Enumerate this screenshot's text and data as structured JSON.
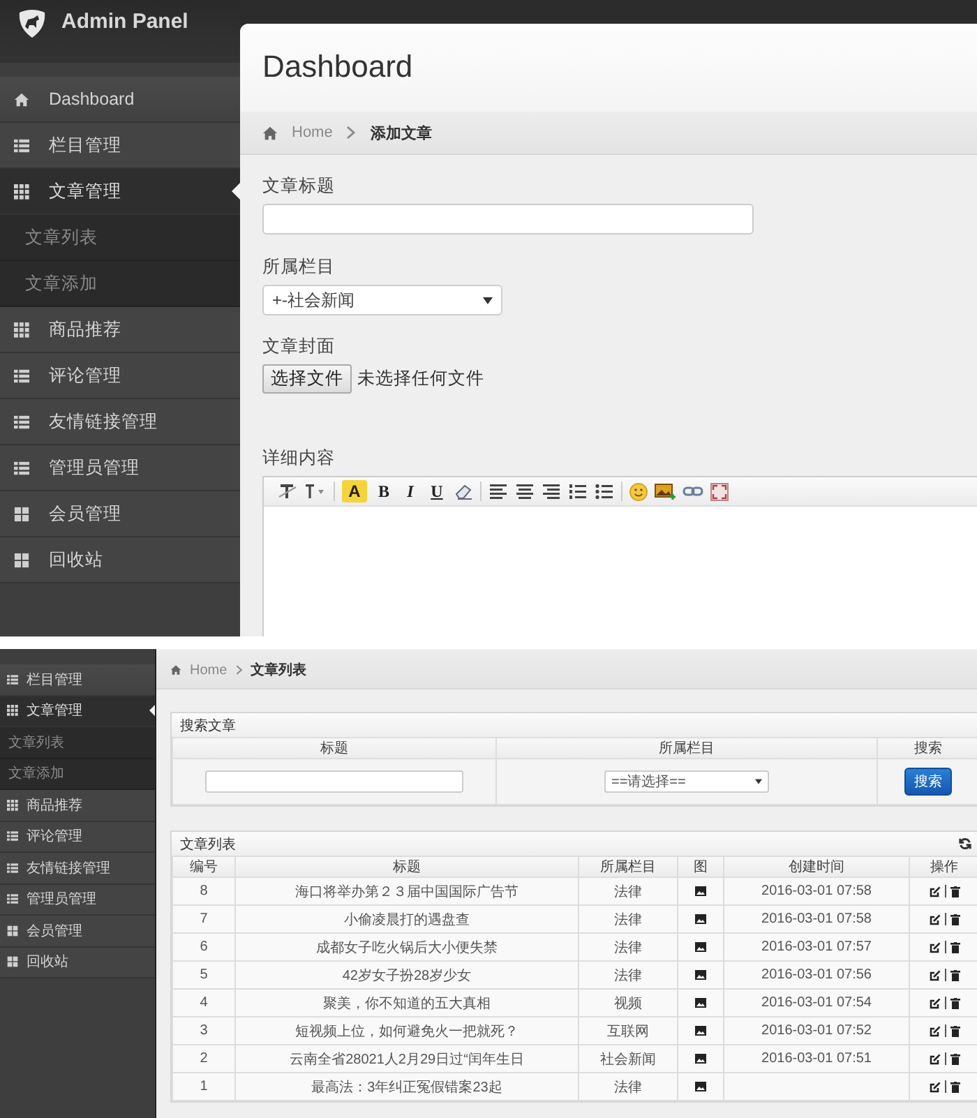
{
  "top_screen": {
    "brand": "Admin Panel",
    "sidebar": {
      "items": [
        {
          "label": "Dashboard",
          "kind": "home",
          "selected": false
        },
        {
          "label": "栏目管理",
          "kind": "list",
          "selected": false
        },
        {
          "label": "文章管理",
          "kind": "grid",
          "selected": true,
          "expanded": true,
          "children": [
            {
              "label": "文章列表"
            },
            {
              "label": "文章添加"
            }
          ]
        },
        {
          "label": "商品推荐",
          "kind": "grid",
          "selected": false
        },
        {
          "label": "评论管理",
          "kind": "list",
          "selected": false
        },
        {
          "label": "友情链接管理",
          "kind": "list",
          "selected": false
        },
        {
          "label": "管理员管理",
          "kind": "list",
          "selected": false
        },
        {
          "label": "会员管理",
          "kind": "tiles",
          "selected": false
        },
        {
          "label": "回收站",
          "kind": "tiles",
          "selected": false
        }
      ]
    },
    "page_title": "Dashboard",
    "breadcrumb": [
      {
        "label": "Home"
      },
      {
        "label": "添加文章"
      }
    ],
    "form": {
      "fields": [
        {
          "kind": "text",
          "label": "文章标题"
        },
        {
          "kind": "select",
          "label": "所属栏目",
          "value": "+-社会新闻"
        },
        {
          "kind": "file",
          "label": "文章封面",
          "button": "选择文件",
          "status": "未选择任何文件"
        },
        {
          "kind": "editor",
          "label": "详细内容",
          "toolbar": [
            {
              "kind": "clear-format"
            },
            {
              "kind": "font-size"
            },
            {
              "kind": "separator"
            },
            {
              "kind": "highlight",
              "label": "A"
            },
            {
              "kind": "bold",
              "label": "B"
            },
            {
              "kind": "italic",
              "label": "I"
            },
            {
              "kind": "underline",
              "label": "U"
            },
            {
              "kind": "eraser"
            },
            {
              "kind": "separator"
            },
            {
              "kind": "align-left"
            },
            {
              "kind": "align-center"
            },
            {
              "kind": "align-right"
            },
            {
              "kind": "ordered-list"
            },
            {
              "kind": "unordered-list"
            },
            {
              "kind": "separator"
            },
            {
              "kind": "emoji"
            },
            {
              "kind": "image"
            },
            {
              "kind": "link"
            },
            {
              "kind": "fullscreen"
            }
          ]
        }
      ]
    }
  },
  "bottom_screen": {
    "sidebar": {
      "items": [
        {
          "label": "栏目管理",
          "kind": "list",
          "selected": false
        },
        {
          "label": "文章管理",
          "kind": "grid",
          "selected": true,
          "expanded": true,
          "children": [
            {
              "label": "文章列表"
            },
            {
              "label": "文章添加"
            }
          ]
        },
        {
          "label": "商品推荐",
          "kind": "grid",
          "selected": false
        },
        {
          "label": "评论管理",
          "kind": "list",
          "selected": false
        },
        {
          "label": "友情链接管理",
          "kind": "list",
          "selected": false
        },
        {
          "label": "管理员管理",
          "kind": "list",
          "selected": false
        },
        {
          "label": "会员管理",
          "kind": "tiles",
          "selected": false
        },
        {
          "label": "回收站",
          "kind": "tiles",
          "selected": false
        }
      ]
    },
    "breadcrumb": [
      {
        "label": "Home"
      },
      {
        "label": "文章列表"
      }
    ],
    "search_panel": {
      "title": "搜索文章",
      "columns": [
        "标题",
        "所属栏目",
        "搜索"
      ],
      "category_select": "==请选择==",
      "search_button": "搜索"
    },
    "list_panel": {
      "title": "文章列表",
      "columns": [
        "编号",
        "标题",
        "所属栏目",
        "图",
        "创建时间",
        "操作"
      ],
      "rows": [
        {
          "id": "8",
          "title": "海口将举办第２３届中国国际广告节",
          "category": "法律",
          "created": "2016-03-01 07:58"
        },
        {
          "id": "7",
          "title": "小偷凌晨打的遇盘查",
          "category": "法律",
          "created": "2016-03-01 07:58"
        },
        {
          "id": "6",
          "title": "成都女子吃火锅后大小便失禁",
          "category": "法律",
          "created": "2016-03-01 07:57"
        },
        {
          "id": "5",
          "title": "42岁女子扮28岁少女",
          "category": "法律",
          "created": "2016-03-01 07:56"
        },
        {
          "id": "4",
          "title": "聚美，你不知道的五大真相",
          "category": "视频",
          "created": "2016-03-01 07:54"
        },
        {
          "id": "3",
          "title": "短视频上位，如何避免火一把就死？",
          "category": "互联网",
          "created": "2016-03-01 07:52"
        },
        {
          "id": "2",
          "title": "云南全省28021人2月29日过“闰年生日",
          "category": "社会新闻",
          "created": "2016-03-01 07:51"
        },
        {
          "id": "1",
          "title": "最高法：3年纠正冤假错案23起",
          "category": "法律"
        }
      ]
    }
  }
}
